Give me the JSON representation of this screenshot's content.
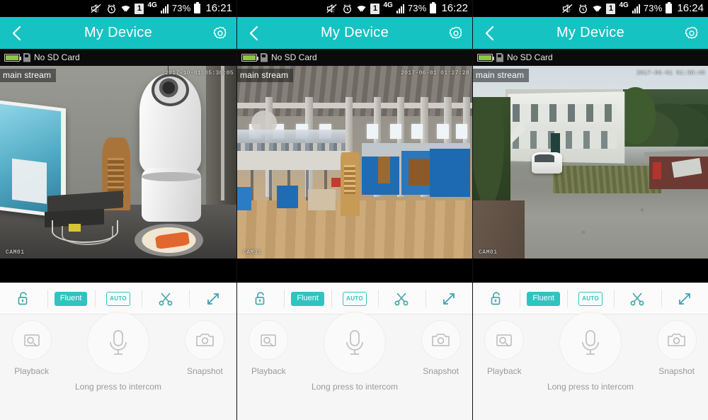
{
  "panels": [
    {
      "statusbar": {
        "battery_pct": "73%",
        "network": "4G",
        "sim": "1",
        "time": "16:21"
      },
      "header": {
        "title": "My Device"
      },
      "sdbar": {
        "text": "No SD Card"
      },
      "video": {
        "stream_label": "main stream",
        "timestamp": "2017-10-01 05:38:05",
        "camera": "CAM01"
      },
      "toolbar": {
        "lock": "unlock-icon",
        "quality": "Fluent",
        "mode": "AUTO",
        "cut": "scissors-icon",
        "expand": "fullscreen-icon"
      },
      "actions": {
        "playback": "Playback",
        "intercom": "Long press to intercom",
        "snapshot": "Snapshot"
      }
    },
    {
      "statusbar": {
        "battery_pct": "73%",
        "network": "4G",
        "sim": "1",
        "time": "16:22"
      },
      "header": {
        "title": "My Device"
      },
      "sdbar": {
        "text": "No SD Card"
      },
      "video": {
        "stream_label": "main stream",
        "timestamp": "2017-06-01 01:27:28",
        "camera": "CAM01"
      },
      "toolbar": {
        "lock": "unlock-icon",
        "quality": "Fluent",
        "mode": "AUTO",
        "cut": "scissors-icon",
        "expand": "fullscreen-icon"
      },
      "actions": {
        "playback": "Playback",
        "intercom": "Long press to intercom",
        "snapshot": "Snapshot"
      }
    },
    {
      "statusbar": {
        "battery_pct": "73%",
        "network": "4G",
        "sim": "1",
        "time": "16:24"
      },
      "header": {
        "title": "My Device"
      },
      "sdbar": {
        "text": "No SD Card"
      },
      "video": {
        "stream_label": "main stream",
        "timestamp": "2017-06-01 01:38:40",
        "camera": "CAM01"
      },
      "toolbar": {
        "lock": "unlock-icon",
        "quality": "Fluent",
        "mode": "AUTO",
        "cut": "scissors-icon",
        "expand": "fullscreen-icon"
      },
      "actions": {
        "playback": "Playback",
        "intercom": "Long press to intercom",
        "snapshot": "Snapshot"
      }
    }
  ],
  "colors": {
    "accent": "#16c2c2",
    "badge_fill": "#2fc4c0",
    "statusbar_bg": "#000000",
    "sdbar_bg": "#0b0b0b",
    "action_bg": "#f6f6f6",
    "label_gray": "#9a9a9a"
  }
}
